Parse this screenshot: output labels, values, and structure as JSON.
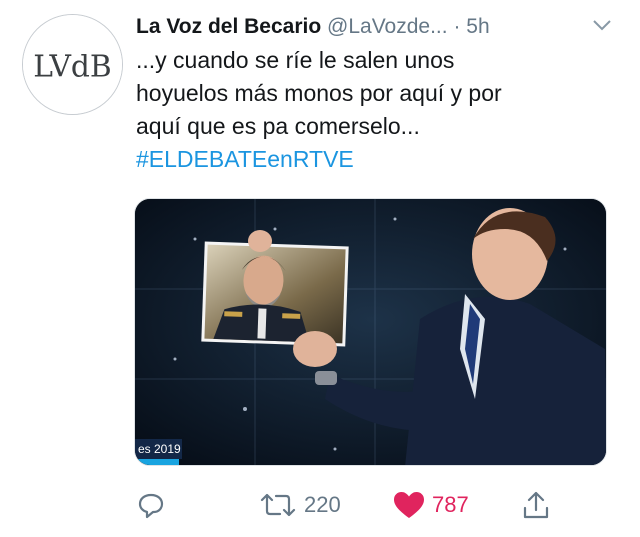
{
  "tweet": {
    "author_name": "La Voz del Becario",
    "author_handle": "@LaVozde...",
    "separator": "·",
    "time": "5h",
    "text_lines": [
      "...y cuando se ríe le salen unos",
      "hoyuelos más monos por aquí y por",
      "aquí que es pa comerselo..."
    ],
    "hashtag": "#ELDEBATEenRTVE",
    "avatar_text": "LVdB",
    "media_overlay_text": "es 2019"
  },
  "actions": {
    "reply_icon": "reply-icon",
    "retweet_icon": "retweet-icon",
    "retweet_count": "220",
    "like_icon": "heart-icon",
    "like_count": "787",
    "share_icon": "share-icon"
  },
  "colors": {
    "link": "#1b95e0",
    "like": "#e0245e",
    "muted": "#657786"
  }
}
